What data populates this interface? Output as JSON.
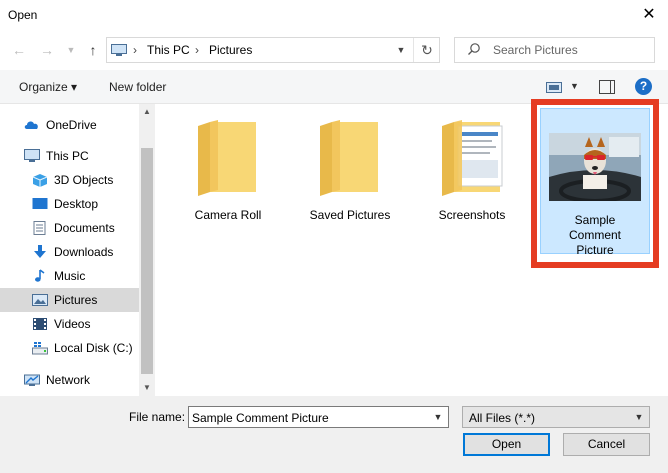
{
  "window": {
    "title": "Open",
    "close_glyph": "✕"
  },
  "nav_buttons": {
    "back_icon": "arrow-left-icon",
    "forward_icon": "arrow-right-icon",
    "recent_icon": "chevron-down-icon",
    "up_icon": "arrow-up-icon"
  },
  "address": {
    "crumbs": [
      "This PC",
      "Pictures"
    ],
    "separator": "›"
  },
  "search": {
    "placeholder": "Search Pictures"
  },
  "toolbar": {
    "organize_label": "Organize ▾",
    "new_folder_label": "New folder",
    "help_label": "?"
  },
  "sidebar": {
    "items": [
      {
        "label": "OneDrive",
        "icon": "cloud-icon"
      },
      {
        "label": "This PC",
        "icon": "computer-icon"
      },
      {
        "label": "3D Objects",
        "icon": "cube-icon"
      },
      {
        "label": "Desktop",
        "icon": "desktop-icon"
      },
      {
        "label": "Documents",
        "icon": "documents-icon"
      },
      {
        "label": "Downloads",
        "icon": "download-icon"
      },
      {
        "label": "Music",
        "icon": "music-icon"
      },
      {
        "label": "Pictures",
        "icon": "pictures-icon",
        "selected": true
      },
      {
        "label": "Videos",
        "icon": "videos-icon"
      },
      {
        "label": "Local Disk (C:)",
        "icon": "drive-icon"
      },
      {
        "label": "Network",
        "icon": "network-icon"
      }
    ]
  },
  "files": {
    "items": [
      {
        "label": "Camera Roll",
        "icon": "folder-icon"
      },
      {
        "label": "Saved Pictures",
        "icon": "folder-icon"
      },
      {
        "label": "Screenshots",
        "icon": "folder-with-documents-icon"
      },
      {
        "label_lines": [
          "Sample",
          "Comment",
          "Picture"
        ],
        "icon": "image-thumbnail",
        "selected": true
      }
    ]
  },
  "bottom": {
    "file_name_label": "File name:",
    "file_name_value": "Sample Comment Picture",
    "file_type_value": "All Files (*.*)",
    "open_label": "Open",
    "cancel_label": "Cancel"
  },
  "colors": {
    "highlight": "#e53c22",
    "selection": "#cce8ff",
    "accent": "#0078d7",
    "folder": "#f8d775"
  }
}
